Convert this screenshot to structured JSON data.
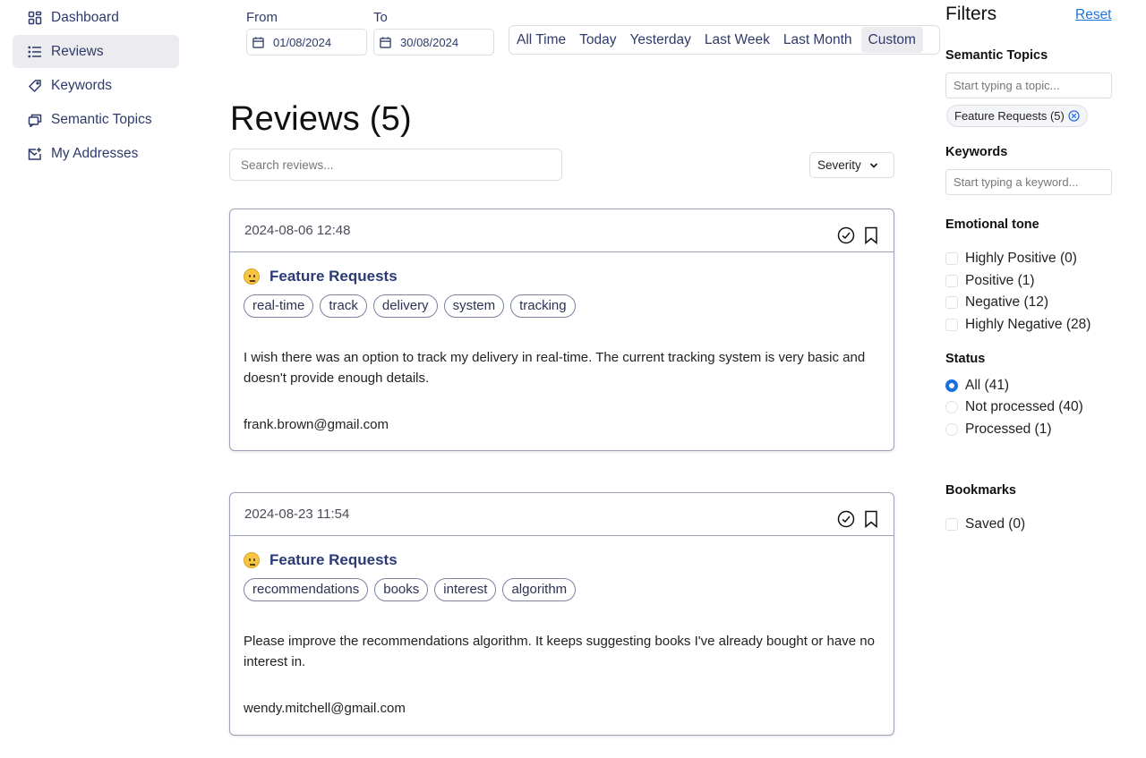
{
  "sidebar": {
    "items": [
      {
        "label": "Dashboard",
        "icon": "dashboard-icon"
      },
      {
        "label": "Reviews",
        "icon": "list-icon",
        "active": true
      },
      {
        "label": "Keywords",
        "icon": "tag-icon"
      },
      {
        "label": "Semantic Topics",
        "icon": "chat-icon"
      },
      {
        "label": "My Addresses",
        "icon": "mail-icon"
      }
    ]
  },
  "date_range": {
    "from_label": "From",
    "from_value": "01/08/2024",
    "to_label": "To",
    "to_value": "30/08/2024",
    "presets": [
      "All Time",
      "Today",
      "Yesterday",
      "Last Week",
      "Last Month",
      "Custom"
    ],
    "active_preset": "Custom"
  },
  "main": {
    "title": "Reviews (5)",
    "search_placeholder": "Search reviews...",
    "sort_label": "Severity"
  },
  "reviews": [
    {
      "date": "2024-08-06 12:48",
      "topic": "Feature Requests",
      "tags": [
        "real-time",
        "track",
        "delivery",
        "system",
        "tracking"
      ],
      "text": "I wish there was an option to track my delivery in real-time. The current tracking system is very basic and doesn't provide enough details.",
      "email": "frank.brown@gmail.com"
    },
    {
      "date": "2024-08-23 11:54",
      "topic": "Feature Requests",
      "tags": [
        "recommendations",
        "books",
        "interest",
        "algorithm"
      ],
      "text": "Please improve the recommendations algorithm. It keeps suggesting books I've already bought or have no interest in.",
      "email": "wendy.mitchell@gmail.com"
    }
  ],
  "filters": {
    "title": "Filters",
    "reset_label": "Reset",
    "topics_heading": "Semantic Topics",
    "topics_placeholder": "Start typing a topic...",
    "topic_chip": "Feature Requests (5)",
    "keywords_heading": "Keywords",
    "keywords_placeholder": "Start typing a keyword...",
    "tone_heading": "Emotional tone",
    "tone_options": [
      "Highly Positive (0)",
      "Positive (1)",
      "Negative (12)",
      "Highly Negative (28)"
    ],
    "status_heading": "Status",
    "status_options": [
      "All (41)",
      "Not processed (40)",
      "Processed (1)"
    ],
    "status_selected": "All (41)",
    "bookmarks_heading": "Bookmarks",
    "bookmark_option": "Saved (0)"
  },
  "colors": {
    "accent": "#2b3a74",
    "link": "#1b74d8",
    "radio_selected": "#1b6fe0",
    "active_bg": "#ececf0"
  }
}
